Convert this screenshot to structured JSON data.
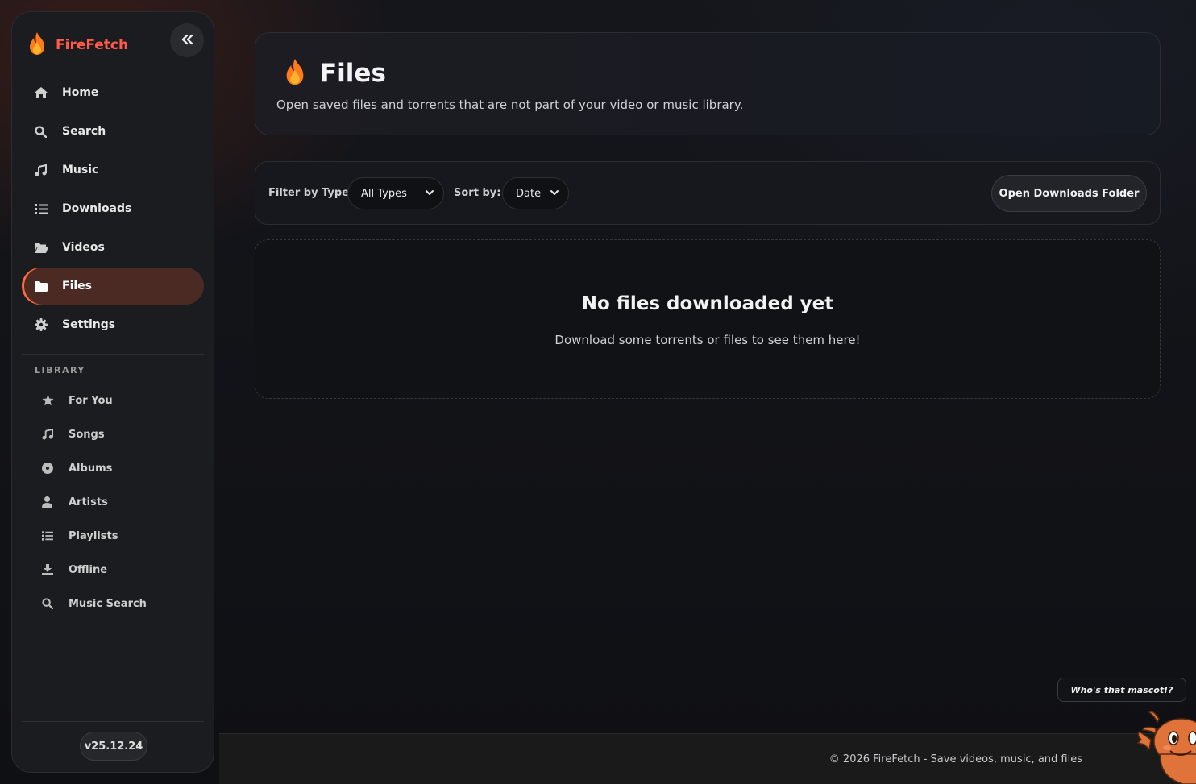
{
  "app": {
    "name": "FireFetch",
    "version": "v25.12.24"
  },
  "nav": {
    "items": [
      {
        "label": "Home",
        "icon": "home-icon"
      },
      {
        "label": "Search",
        "icon": "search-icon"
      },
      {
        "label": "Music",
        "icon": "music-note-icon"
      },
      {
        "label": "Downloads",
        "icon": "list-icon"
      },
      {
        "label": "Videos",
        "icon": "folder-open-icon"
      },
      {
        "label": "Files",
        "icon": "folder-icon",
        "active": true
      },
      {
        "label": "Settings",
        "icon": "gear-icon"
      }
    ]
  },
  "library": {
    "heading": "LIBRARY",
    "items": [
      {
        "label": "For You",
        "icon": "star-icon"
      },
      {
        "label": "Songs",
        "icon": "music-note-icon"
      },
      {
        "label": "Albums",
        "icon": "disc-icon"
      },
      {
        "label": "Artists",
        "icon": "user-icon"
      },
      {
        "label": "Playlists",
        "icon": "list-icon"
      },
      {
        "label": "Offline",
        "icon": "download-icon"
      },
      {
        "label": "Music Search",
        "icon": "search-icon"
      }
    ]
  },
  "header": {
    "title": "Files",
    "subtitle": "Open saved files and torrents that are not part of your video or music library."
  },
  "filters": {
    "type_label": "Filter by Type:",
    "type_value": "All Types",
    "sort_label": "Sort by:",
    "sort_value": "Date",
    "open_button": "Open Downloads Folder"
  },
  "empty": {
    "title": "No files downloaded yet",
    "subtitle": "Download some torrents or files to see them here!"
  },
  "footer": {
    "text": "© 2026 FireFetch - Save videos, music, and files"
  },
  "mascot": {
    "bubble": "Who's that mascot!?"
  },
  "colors": {
    "accent": "#ff6a3a",
    "brand": "#ff5a4a",
    "active_bg": "#4a2a22"
  }
}
